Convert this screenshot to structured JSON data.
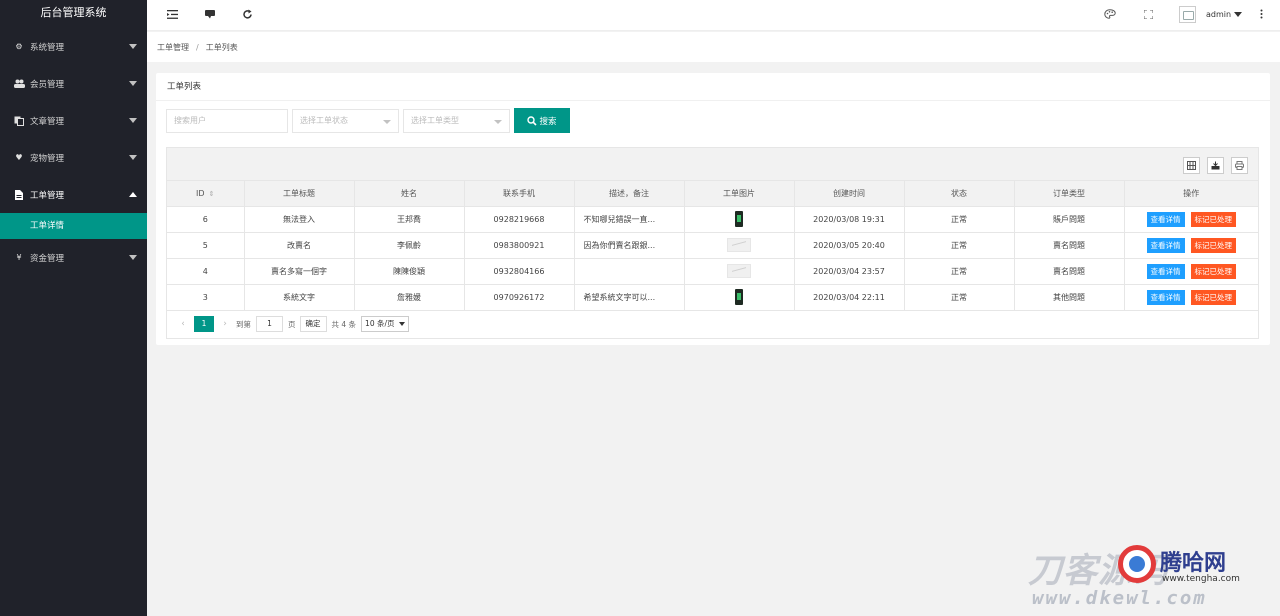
{
  "app": {
    "title": "后台管理系统"
  },
  "sidebar": {
    "items": [
      {
        "label": "系统管理",
        "icon": "gear-icon"
      },
      {
        "label": "会员管理",
        "icon": "users-icon"
      },
      {
        "label": "文章管理",
        "icon": "copy-icon"
      },
      {
        "label": "宠物管理",
        "icon": "heart-icon"
      },
      {
        "label": "工单管理",
        "icon": "file-icon",
        "open": true,
        "children": [
          "工单详情"
        ]
      },
      {
        "label": "资金管理",
        "icon": "yen-icon"
      }
    ]
  },
  "header": {
    "user": "admin"
  },
  "breadcrumb": {
    "parent": "工单管理",
    "current": "工单列表"
  },
  "card": {
    "title": "工单列表"
  },
  "filters": {
    "user_placeholder": "搜索用户",
    "status_placeholder": "选择工单状态",
    "type_placeholder": "选择工单类型",
    "search_label": "搜索"
  },
  "table": {
    "headers": [
      "ID",
      "工单标题",
      "姓名",
      "联系手机",
      "描述，备注",
      "工单图片",
      "创建时间",
      "状态",
      "订单类型",
      "操作"
    ],
    "rows": [
      {
        "id": "6",
        "title": "無法登入",
        "name": "王邦喬",
        "phone": "0928219668",
        "desc": "不知哪兒錯誤一直...",
        "image": "photo",
        "created": "2020/03/08 19:31",
        "status": "正常",
        "type": "賬戶問題"
      },
      {
        "id": "5",
        "title": "改賣名",
        "name": "李佩齡",
        "phone": "0983800921",
        "desc": "因為你們賣名跟銀...",
        "image": "placeholder",
        "created": "2020/03/05 20:40",
        "status": "正常",
        "type": "賣名問題"
      },
      {
        "id": "4",
        "title": "賣名多寫一個字",
        "name": "陳陳俊穎",
        "phone": "0932804166",
        "desc": "",
        "image": "placeholder",
        "created": "2020/03/04 23:57",
        "status": "正常",
        "type": "賣名問題"
      },
      {
        "id": "3",
        "title": "系統文字",
        "name": "詹雅媛",
        "phone": "0970926172",
        "desc": "希望系統文字可以...",
        "image": "photo",
        "created": "2020/03/04 22:11",
        "status": "正常",
        "type": "其他問題"
      }
    ],
    "actions": {
      "view": "查看详情",
      "mark": "标记已处理"
    }
  },
  "pager": {
    "current": "1",
    "goto_label": "到第",
    "page_value": "1",
    "page_unit": "页",
    "confirm": "确定",
    "total": "共 4 条",
    "page_size": "10 条/页"
  },
  "watermark": {
    "brand": "腾哈网",
    "site": "www.tengha.com",
    "big": "刀客源码",
    "url": "www.dkewl.com"
  }
}
